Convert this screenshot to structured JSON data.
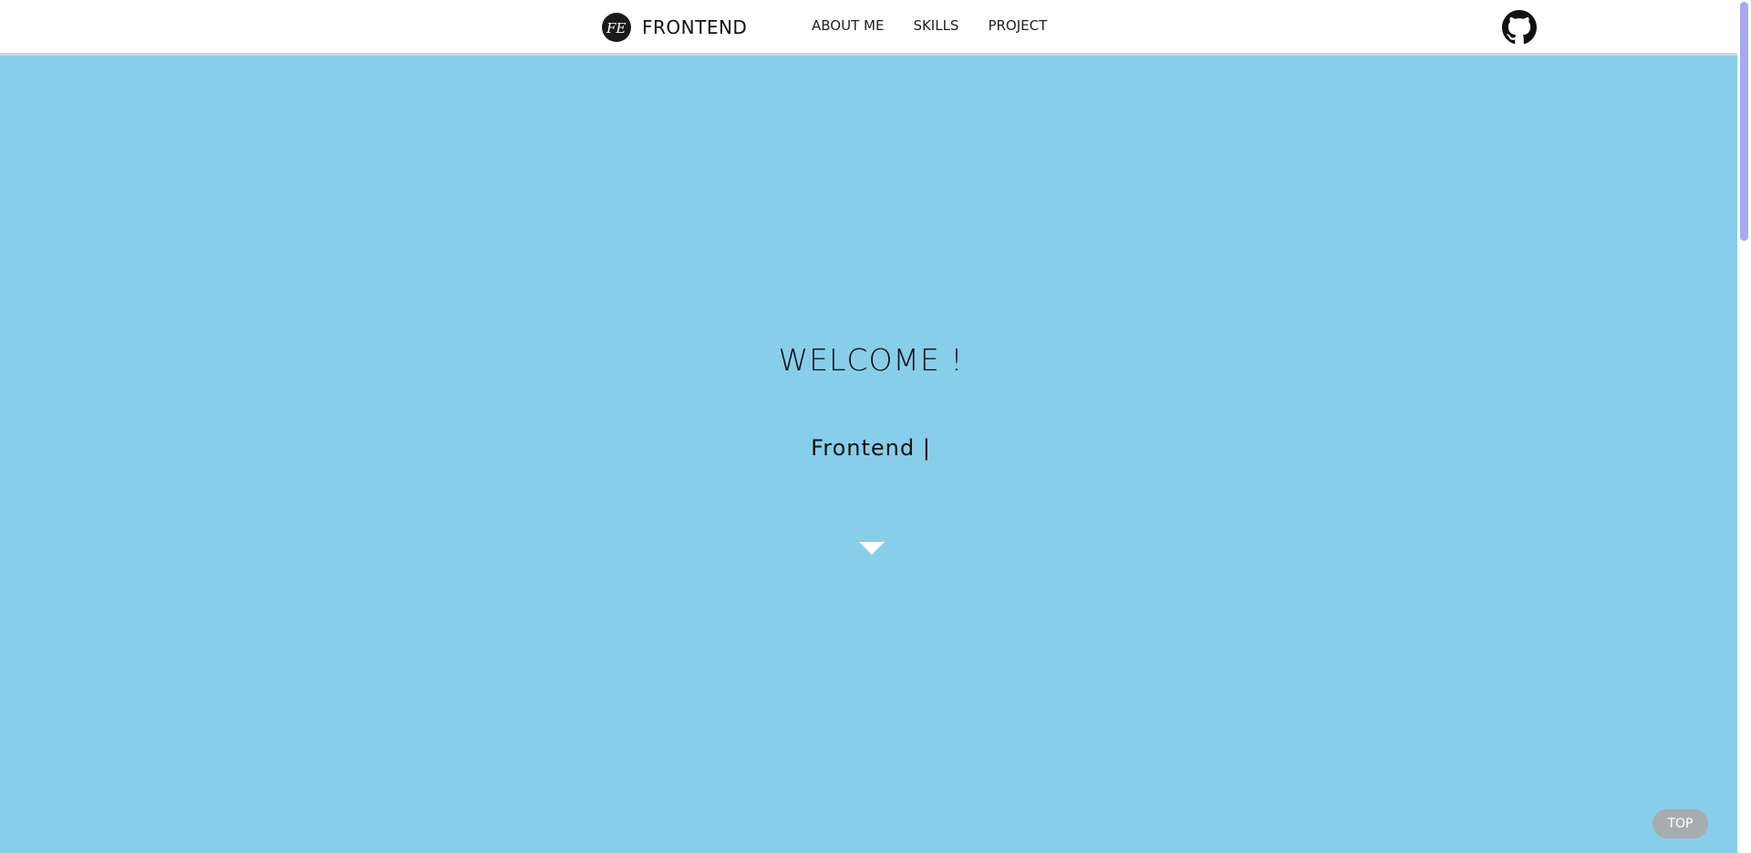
{
  "header": {
    "brand_name": "FRONTEND",
    "logo_text": "FE",
    "nav": [
      {
        "label": "ABOUT ME"
      },
      {
        "label": "SKILLS"
      },
      {
        "label": "PROJECT"
      }
    ],
    "github_icon": "github-icon"
  },
  "hero": {
    "title": "WELCOME !",
    "subtitle": "Frontend |",
    "arrow_icon": "caret-down-icon"
  },
  "top_button": {
    "label": "TOP"
  },
  "colors": {
    "background": "#87ceea",
    "header_bg": "#ffffff",
    "scrollbar_thumb": "#a8a8f5",
    "top_button_bg": "#a8acb0"
  }
}
